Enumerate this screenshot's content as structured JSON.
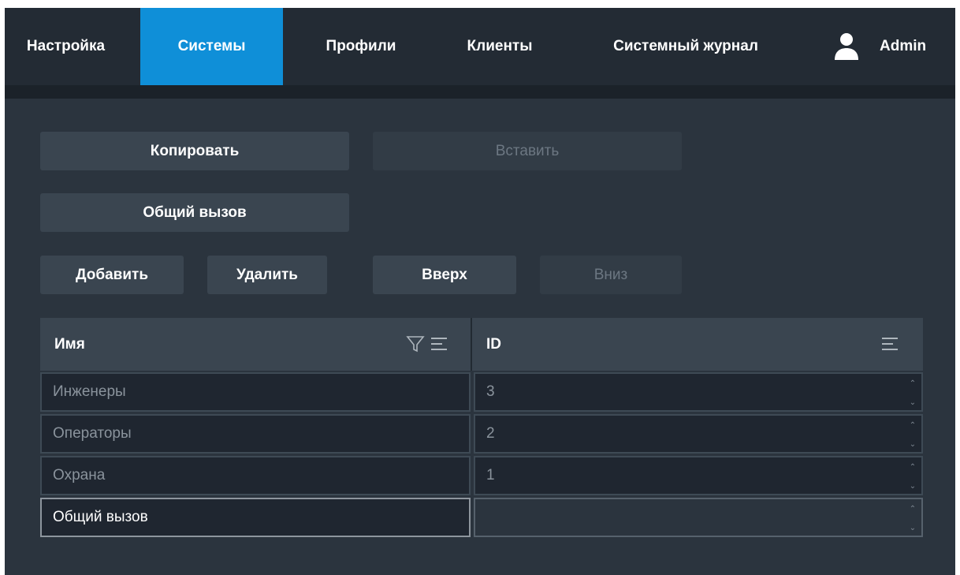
{
  "nav": {
    "tabs": [
      {
        "label": "Настройка",
        "active": false
      },
      {
        "label": "Системы",
        "active": true
      },
      {
        "label": "Профили",
        "active": false
      },
      {
        "label": "Клиенты",
        "active": false
      },
      {
        "label": "Системный журнал",
        "active": false
      }
    ],
    "user": {
      "icon": "user-icon",
      "name": "Admin"
    }
  },
  "toolbar": {
    "copy_label": "Копировать",
    "paste_label": "Вставить",
    "general_call_label": "Общий вызов",
    "add_label": "Добавить",
    "delete_label": "Удалить",
    "up_label": "Вверх",
    "down_label": "Вниз"
  },
  "table": {
    "columns": [
      {
        "label": "Имя",
        "icons": [
          "filter-icon",
          "sort-icon"
        ]
      },
      {
        "label": "ID",
        "icons": [
          "sort-icon"
        ]
      }
    ],
    "rows": [
      {
        "name": "Инженеры",
        "id": "3"
      },
      {
        "name": "Операторы",
        "id": "2"
      },
      {
        "name": "Охрана",
        "id": "1"
      },
      {
        "name": "Общий вызов",
        "id": ""
      }
    ]
  },
  "colors": {
    "accent": "#0f8fd8",
    "nav_bg": "#232b34",
    "panel_bg": "#2b343e",
    "button_bg": "#3a4550",
    "cell_bg": "#1f2630"
  }
}
